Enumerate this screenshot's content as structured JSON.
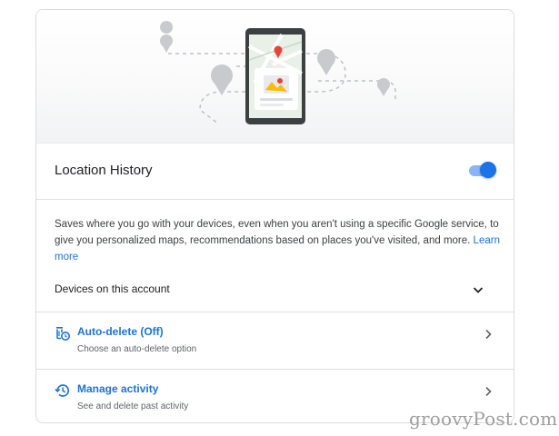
{
  "location_history": {
    "title": "Location History",
    "toggle_state": "on",
    "description": "Saves where you go with your devices, even when you aren't using a specific Google service, to give you personalized maps, recommendations based on places you've visited, and more.",
    "learn_more": "Learn more"
  },
  "devices": {
    "label": "Devices on this account"
  },
  "auto_delete": {
    "title": "Auto-delete (Off)",
    "subtitle": "Choose an auto-delete option"
  },
  "manage_activity": {
    "title": "Manage activity",
    "subtitle": "See and delete past activity"
  },
  "watermark": "groovyPost.com",
  "colors": {
    "accent": "#1a73e8",
    "toggle_track": "#8ab4f8",
    "pin_red": "#ea4335",
    "phone_frame": "#3c4043"
  },
  "icons": {
    "hero": "phone-map-illustration",
    "expand": "chevron-down-icon",
    "auto_delete": "auto-delete-icon",
    "manage_activity": "history-icon",
    "row_arrow": "chevron-right-icon"
  }
}
